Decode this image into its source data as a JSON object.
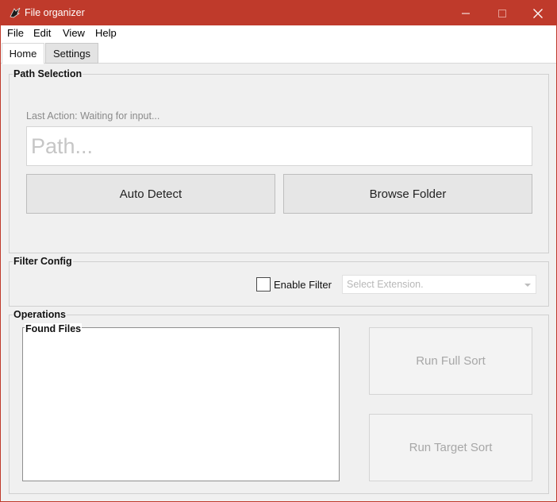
{
  "window": {
    "title": "File organizer",
    "accent_color": "#bf3a2b",
    "icons": {
      "app": "app-logo-icon",
      "minimize": "minimize-icon",
      "maximize": "maximize-icon",
      "close": "close-icon"
    }
  },
  "menu": {
    "items": [
      "File",
      "Edit",
      "View",
      "Help"
    ]
  },
  "tabs": {
    "home": "Home",
    "settings": "Settings",
    "active": "Home"
  },
  "path_selection": {
    "label": "Path Selection",
    "last_action": "Last Action: Waiting for input...",
    "path_value": "",
    "path_placeholder": "Path...",
    "auto_detect_label": "Auto Detect",
    "browse_folder_label": "Browse Folder"
  },
  "filter_config": {
    "label": "Filter Config",
    "enable_filter_label": "Enable Filter",
    "enable_filter_checked": false,
    "extension_placeholder": "Select Extension."
  },
  "operations": {
    "label": "Operations",
    "found_files_label": "Found Files",
    "found_files": [],
    "run_full_sort_label": "Run Full Sort",
    "run_target_sort_label": "Run Target Sort"
  }
}
